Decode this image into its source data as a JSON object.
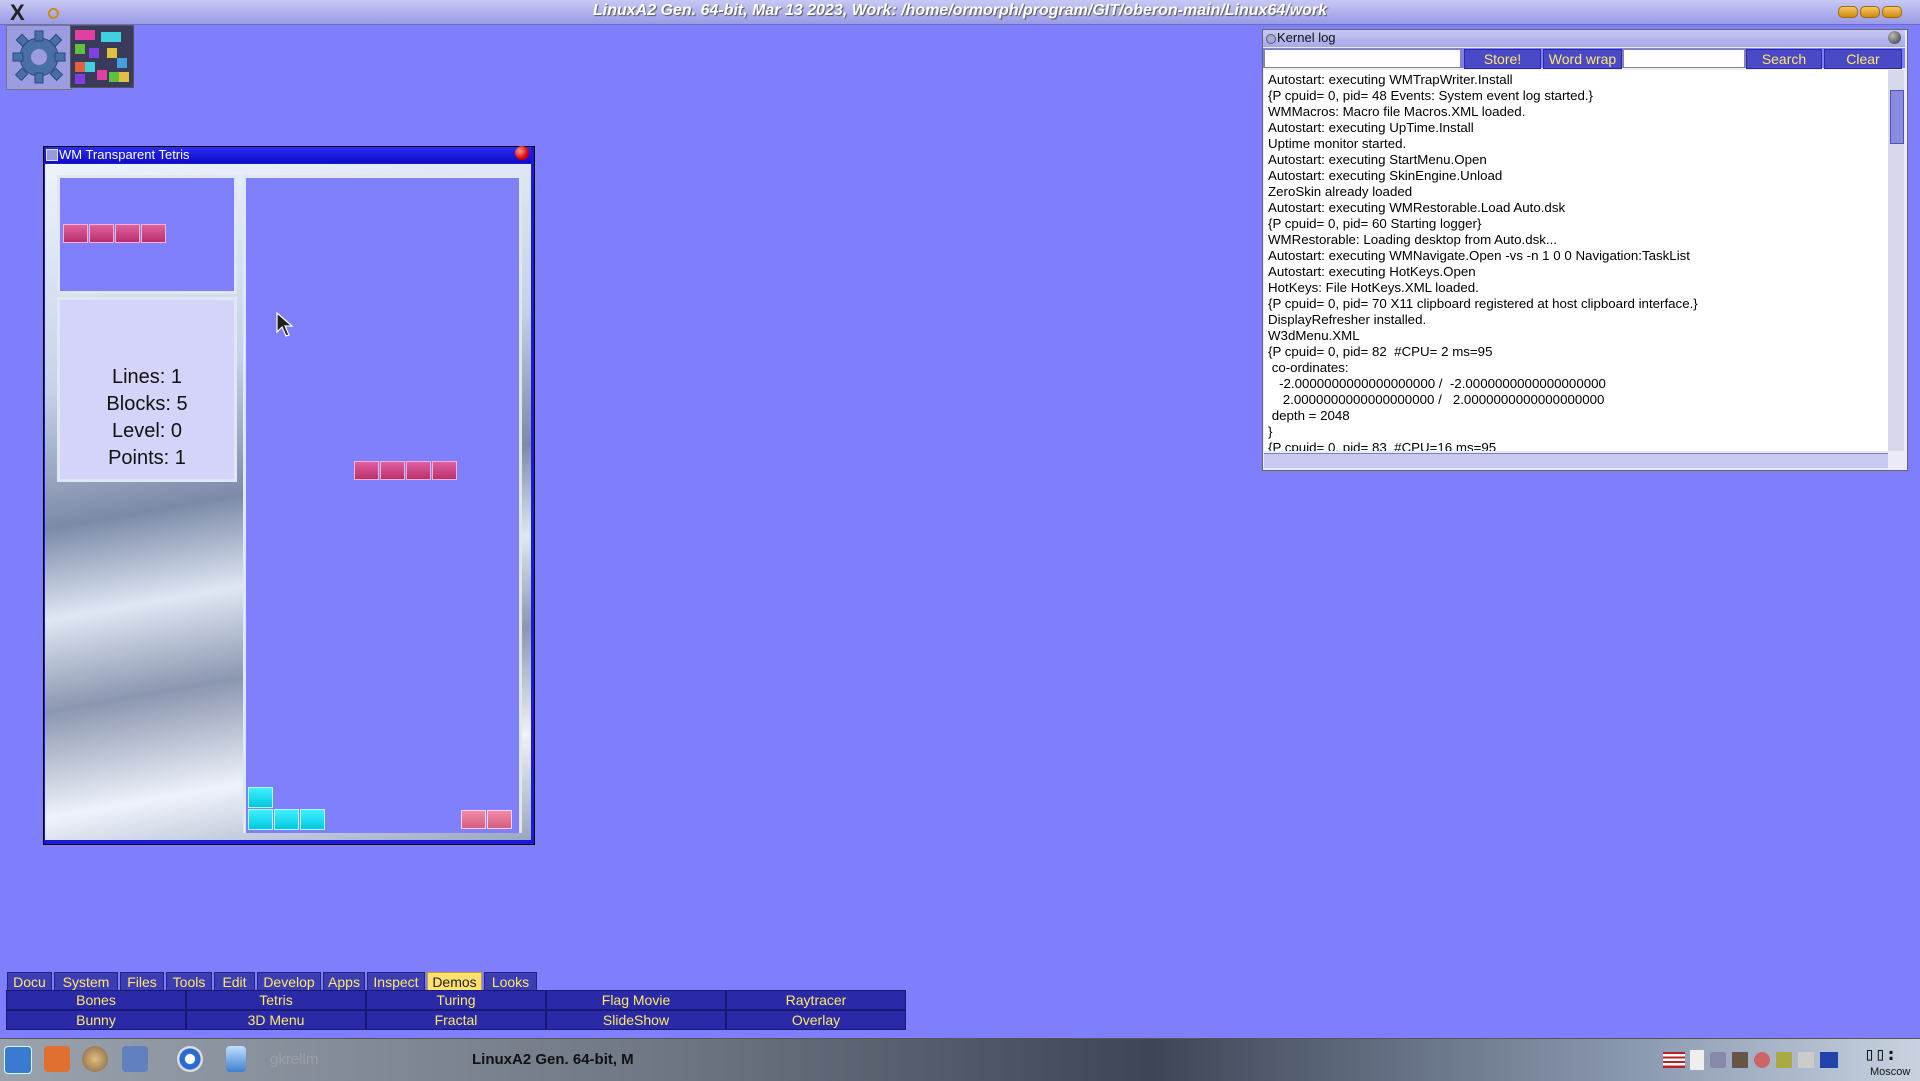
{
  "topbar": {
    "title": "LinuxA2 Gen. 64-bit, Mar 13 2023,  Work: /home/ormorph/program/GIT/oberon-main/Linux64/work",
    "logo": "X"
  },
  "tetris": {
    "window_title": "WM Transparent Tetris",
    "stats": {
      "lines": "Lines: 1",
      "blocks": "Blocks: 5",
      "level": "Level: 0",
      "points": "Points: 1"
    },
    "colors": {
      "board": "#8080fc",
      "piece": "#c8407e",
      "cyan": "#20e0f0"
    }
  },
  "kernel_log": {
    "title": "Kernel log",
    "buttons": {
      "store": "Store!",
      "wordwrap": "Word wrap",
      "search": "Search",
      "clear": "Clear"
    },
    "lines": [
      "Autostart: executing WMTrapWriter.Install",
      "{P cpuid= 0, pid= 48 Events: System event log started.}",
      "WMMacros: Macro file Macros.XML loaded.",
      "Autostart: executing UpTime.Install",
      "Uptime monitor started.",
      "Autostart: executing StartMenu.Open",
      "Autostart: executing SkinEngine.Unload",
      "ZeroSkin already loaded",
      "Autostart: executing WMRestorable.Load Auto.dsk",
      "{P cpuid= 0, pid= 60 Starting logger}",
      "WMRestorable: Loading desktop from Auto.dsk...",
      "Autostart: executing WMNavigate.Open -vs -n 1 0 0 Navigation:TaskList",
      "Autostart: executing HotKeys.Open",
      "HotKeys: File HotKeys.XML loaded.",
      "{P cpuid= 0, pid= 70 X11 clipboard registered at host clipboard interface.}",
      "DisplayRefresher installed.",
      "W3dMenu.XML",
      "{P cpuid= 0, pid= 82  #CPU= 2 ms=95",
      " co-ordinates:",
      "   -2.0000000000000000000 /  -2.0000000000000000000",
      "    2.0000000000000000000 /   2.0000000000000000000",
      " depth = 2048",
      "}",
      "{P cpuid= 0, pid= 83  #CPU=16 ms=95"
    ]
  },
  "menu": {
    "tabs": [
      "Docu",
      "System",
      "Files",
      "Tools",
      "Edit",
      "Develop",
      "Apps",
      "Inspect",
      "Demos",
      "Looks"
    ],
    "selected_tab": "Demos",
    "row1": [
      "Bones",
      "Tetris",
      "Turing",
      "Flag Movie",
      "Raytracer"
    ],
    "row2": [
      "Bunny",
      "3D Menu",
      "Fractal",
      "SlideShow",
      "Overlay"
    ]
  },
  "taskbar": {
    "item1": "gkrellm",
    "item2": "LinuxA2 Gen. 64-bit, M",
    "clock_city": "Moscow",
    "icons": [
      "kde-start-icon",
      "home-icon",
      "network-globe-icon",
      "mail-icon",
      "chromium-icon",
      "files-icon"
    ]
  }
}
